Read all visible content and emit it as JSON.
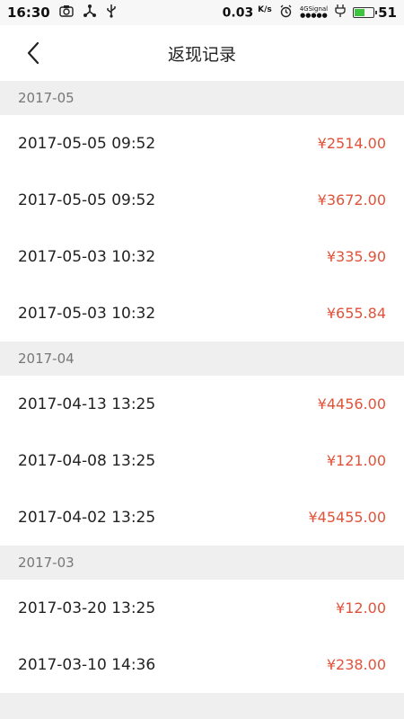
{
  "status": {
    "time": "16:30",
    "speed": "0.03",
    "speed_unit": "K/s",
    "signal_label": "4G",
    "signal_sub": "Signal",
    "battery_level": 0.51,
    "battery": "51"
  },
  "header": {
    "title": "返现记录"
  },
  "groups": [
    {
      "month": "2017-05",
      "records": [
        {
          "datetime": "2017-05-05 09:52",
          "amount": "¥2514.00"
        },
        {
          "datetime": "2017-05-05 09:52",
          "amount": "¥3672.00"
        },
        {
          "datetime": "2017-05-03 10:32",
          "amount": "¥335.90"
        },
        {
          "datetime": "2017-05-03 10:32",
          "amount": "¥655.84"
        }
      ]
    },
    {
      "month": "2017-04",
      "records": [
        {
          "datetime": "2017-04-13 13:25",
          "amount": "¥4456.00"
        },
        {
          "datetime": "2017-04-08 13:25",
          "amount": "¥121.00"
        },
        {
          "datetime": "2017-04-02 13:25",
          "amount": "¥45455.00"
        }
      ]
    },
    {
      "month": "2017-03",
      "records": [
        {
          "datetime": "2017-03-20 13:25",
          "amount": "¥12.00"
        },
        {
          "datetime": "2017-03-10 14:36",
          "amount": "¥238.00"
        }
      ]
    }
  ],
  "colors": {
    "amount": "#e0533a",
    "background": "#efefef"
  }
}
